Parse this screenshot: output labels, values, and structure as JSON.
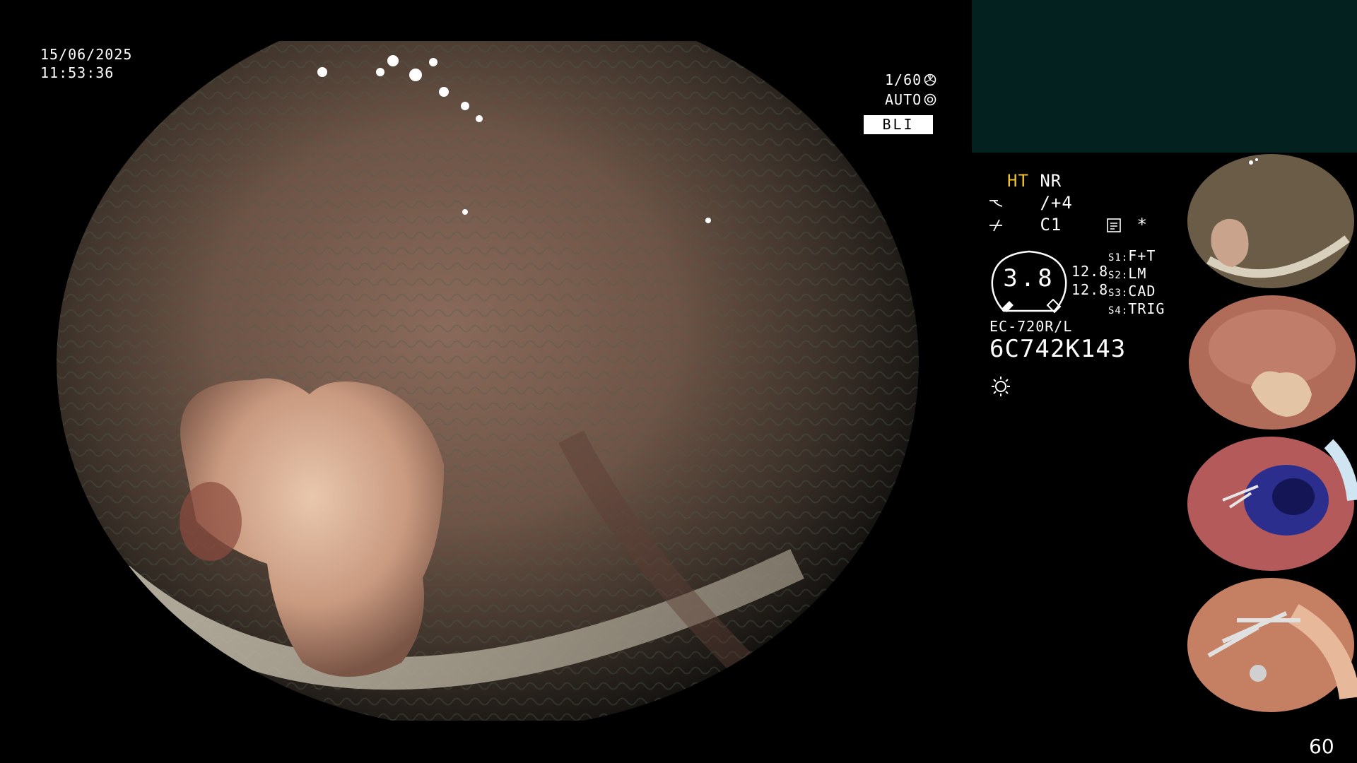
{
  "osd": {
    "date": "15/06/2025",
    "time": "11:53:36",
    "shutter": "1/60",
    "iris": "AUTO",
    "mode": "BLI"
  },
  "status": {
    "ht": "HT",
    "nr": "NR",
    "enhance": "/+4",
    "color": "C1",
    "asterisk": "*",
    "gauge_value": "3.8",
    "left_val_1": "12.8",
    "left_val_2": "12.8",
    "s1_key": "S1:",
    "s1_val": "F+T",
    "s2_key": "S2:",
    "s2_val": "LM",
    "s3_key": "S3:",
    "s3_val": "CAD",
    "s4_key": "S4:",
    "s4_val": "TRIG",
    "model": "EC-720R/L",
    "serial": "6C742K143"
  },
  "page": {
    "number": "60"
  },
  "thumbnails": [
    {
      "name": "thumb-polyp-bli"
    },
    {
      "name": "thumb-polyp-white-light"
    },
    {
      "name": "thumb-injection-blue"
    },
    {
      "name": "thumb-clips"
    }
  ],
  "icons": {
    "shutter": "shutter-icon",
    "iris": "iris-icon",
    "light": "light-icon",
    "record": "record-icon",
    "enhance": "enhance-icon",
    "color": "color-icon"
  }
}
